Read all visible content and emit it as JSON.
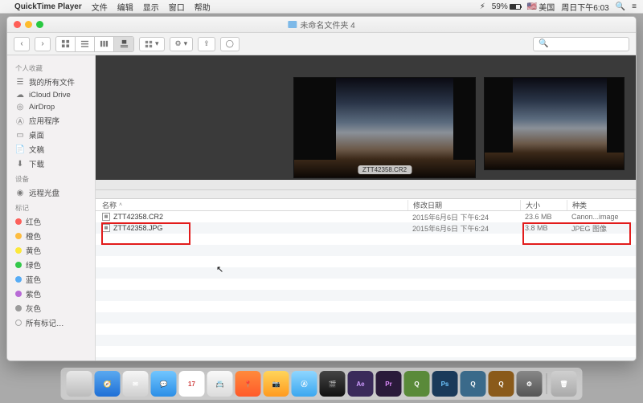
{
  "menubar": {
    "app_name": "QuickTime Player",
    "items": [
      "文件",
      "编辑",
      "显示",
      "窗口",
      "帮助"
    ],
    "battery_pct": "59%",
    "input_source": "美国",
    "clock": "周日下午6:03"
  },
  "window": {
    "title": "未命名文件夹 4",
    "search_placeholder": ""
  },
  "sidebar": {
    "favorites_hdr": "个人收藏",
    "favorites": [
      {
        "icon": "all-files",
        "label": "我的所有文件"
      },
      {
        "icon": "icloud",
        "label": "iCloud Drive"
      },
      {
        "icon": "airdrop",
        "label": "AirDrop"
      },
      {
        "icon": "apps",
        "label": "应用程序"
      },
      {
        "icon": "desktop",
        "label": "桌面"
      },
      {
        "icon": "documents",
        "label": "文稿"
      },
      {
        "icon": "downloads",
        "label": "下载"
      }
    ],
    "devices_hdr": "设备",
    "devices": [
      {
        "icon": "remote-disc",
        "label": "远程光盘"
      }
    ],
    "tags_hdr": "标记",
    "tags": [
      {
        "color": "#fc605b",
        "label": "红色"
      },
      {
        "color": "#fdbc40",
        "label": "橙色"
      },
      {
        "color": "#fce83a",
        "label": "黄色"
      },
      {
        "color": "#34c84a",
        "label": "绿色"
      },
      {
        "color": "#57acf5",
        "label": "蓝色"
      },
      {
        "color": "#b86bd6",
        "label": "紫色"
      },
      {
        "color": "#9b9b9b",
        "label": "灰色"
      },
      {
        "color": "",
        "label": "所有标记…"
      }
    ]
  },
  "preview": {
    "selected_label": "ZTT42358.CR2"
  },
  "columns": {
    "name": "名称",
    "date": "修改日期",
    "size": "大小",
    "kind": "种类"
  },
  "files": [
    {
      "name": "ZTT42358.CR2",
      "date": "2015年6月6日 下午6:24",
      "size": "23.6 MB",
      "kind": "Canon...image"
    },
    {
      "name": "ZTT42358.JPG",
      "date": "2015年6月6日 下午6:24",
      "size": "3.8 MB",
      "kind": "JPEG 图像"
    }
  ],
  "dock": [
    {
      "bg": "linear-gradient(#e8e8e8,#bcbcbc)",
      "txt": "",
      "label": "😀"
    },
    {
      "bg": "linear-gradient(#5aa9f0,#1f6fd6)",
      "txt": "🧭",
      "label": "safari"
    },
    {
      "bg": "linear-gradient(#f6f6f6,#d0d0d0)",
      "txt": "✉︎",
      "label": "mail"
    },
    {
      "bg": "linear-gradient(#71c6ff,#2b8ee6)",
      "txt": "💬",
      "label": "messages"
    },
    {
      "bg": "#fff",
      "txt": "17",
      "label": "calendar",
      "color": "#d04040"
    },
    {
      "bg": "linear-gradient(#f9f9f9,#dcdcdc)",
      "txt": "📇",
      "label": "contacts"
    },
    {
      "bg": "linear-gradient(#ff8a3c,#ff5a2a)",
      "txt": "📍",
      "label": "maps"
    },
    {
      "bg": "linear-gradient(#ffd55a,#ff9a1f)",
      "txt": "📷",
      "label": "photos"
    },
    {
      "bg": "linear-gradient(#8fd6ff,#3aa7ef)",
      "txt": "Ⓐ",
      "label": "appstore"
    },
    {
      "bg": "linear-gradient(#444,#111)",
      "txt": "🎬",
      "label": "fcp"
    },
    {
      "bg": "#3a2a5a",
      "txt": "Ae",
      "label": "ae",
      "color": "#cf9bff"
    },
    {
      "bg": "#2a1a3a",
      "txt": "Pr",
      "label": "pr",
      "color": "#e18bff"
    },
    {
      "bg": "#5a8a3a",
      "txt": "Q",
      "label": "q1",
      "color": "#fff"
    },
    {
      "bg": "#1a3a5a",
      "txt": "Ps",
      "label": "ps",
      "color": "#6ec6ff"
    },
    {
      "bg": "#3a6a8a",
      "txt": "Q",
      "label": "q2",
      "color": "#fff"
    },
    {
      "bg": "#8a5a1a",
      "txt": "Q",
      "label": "q3",
      "color": "#fff"
    },
    {
      "bg": "linear-gradient(#888,#555)",
      "txt": "⚙︎",
      "label": "settings"
    },
    {
      "bg": "linear-gradient(#d0d0d0,#aaa)",
      "txt": "🗑",
      "label": "trash",
      "sep_before": true
    }
  ]
}
